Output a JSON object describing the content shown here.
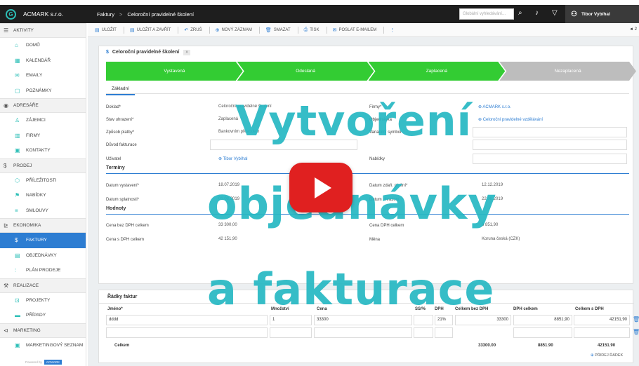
{
  "app": {
    "logo_letter": "G",
    "company": "ACMARK s.r.o."
  },
  "breadcrumb": {
    "root": "Faktury",
    "separator": ">",
    "current": "Celoroční pravidelné školení"
  },
  "search": {
    "placeholder": "Globální vyhledávání..."
  },
  "user": {
    "name": "Tibor Vybíhal"
  },
  "sidebar": {
    "sections": [
      {
        "label": "AKTIVITY",
        "icon": "activity-icon",
        "items": [
          {
            "label": "DOMŮ",
            "icon": "home-icon"
          },
          {
            "label": "KALENDÁŘ",
            "icon": "calendar-icon"
          },
          {
            "label": "EMAILY",
            "icon": "mail-icon"
          },
          {
            "label": "POZNÁMKY",
            "icon": "note-icon"
          }
        ]
      },
      {
        "label": "ADRESÁŘE",
        "icon": "addressbook-icon",
        "items": [
          {
            "label": "ZÁJEMCI",
            "icon": "person-icon"
          },
          {
            "label": "FIRMY",
            "icon": "building-icon"
          },
          {
            "label": "KONTAKTY",
            "icon": "contact-icon"
          }
        ]
      },
      {
        "label": "PRODEJ",
        "icon": "dollar-icon",
        "items": [
          {
            "label": "PŘÍLEŽITOSTI",
            "icon": "opportunity-icon"
          },
          {
            "label": "NABÍDKY",
            "icon": "offer-icon"
          },
          {
            "label": "SMLOUVY",
            "icon": "contract-icon"
          }
        ]
      },
      {
        "label": "EKONOMIKA",
        "icon": "chart-icon",
        "items": [
          {
            "label": "FAKTURY",
            "icon": "invoice-icon",
            "active": true
          },
          {
            "label": "OBJEDNÁVKY",
            "icon": "order-icon"
          },
          {
            "label": "PLÁN PRODEJE",
            "icon": "plan-icon"
          }
        ]
      },
      {
        "label": "REALIZACE",
        "icon": "realization-icon",
        "items": [
          {
            "label": "PROJEKTY",
            "icon": "project-icon"
          },
          {
            "label": "PŘÍPADY",
            "icon": "case-icon"
          }
        ]
      },
      {
        "label": "MARKETING",
        "icon": "marketing-icon",
        "items": [
          {
            "label": "MARKETINGOVÝ SEZNAM",
            "icon": "list-icon"
          }
        ]
      }
    ],
    "footer": {
      "text": "Powered by",
      "brand": "ACMARK"
    }
  },
  "toolbar": {
    "buttons": [
      {
        "label": "ULOŽIT",
        "icon": "save-icon"
      },
      {
        "label": "ULOŽIT A ZAVŘÍT",
        "icon": "save-close-icon"
      },
      {
        "label": "ZRUŠ",
        "icon": "undo-icon"
      },
      {
        "label": "NOVÝ ZÁZNAM",
        "icon": "plus-icon"
      },
      {
        "label": "SMAZAT",
        "icon": "trash-icon"
      },
      {
        "label": "TISK",
        "icon": "print-icon"
      },
      {
        "label": "POSLAT E-MAILEM",
        "icon": "email-icon"
      }
    ],
    "more": "⋮",
    "pager": "◄ 2"
  },
  "record": {
    "title_symbol": "$",
    "title": "Celoroční pravidelné školení",
    "title_button": "×",
    "steps": [
      {
        "label": "Vystavená",
        "state": "done"
      },
      {
        "label": "Odeslaná",
        "state": "done"
      },
      {
        "label": "Zaplacená",
        "state": "done"
      },
      {
        "label": "Nezaplacená",
        "state": "todo"
      }
    ],
    "tab": "Základní",
    "fields": {
      "doklad": {
        "label": "Doklad*",
        "value": "Celoroční pravidelné školení"
      },
      "stav": {
        "label": "Stav uhrazení*",
        "value": "Zaplacená"
      },
      "zpusob": {
        "label": "Způsob platby*",
        "value": "Bankovním převodem"
      },
      "duvod": {
        "label": "Důvod fakturace",
        "value": ""
      },
      "uzivatel": {
        "label": "Uživatel",
        "value": "Tibor Vybíhal"
      },
      "firmy": {
        "label": "Firmy*",
        "value": "ACMARK s.r.o."
      },
      "objednavka": {
        "label": "Objednávka",
        "value": "Celoroční pravidelné vzdělávání"
      },
      "variabilni": {
        "label": "Variabilní symbol",
        "value": ""
      },
      "nabidky": {
        "label": "Nabídky",
        "value": ""
      }
    },
    "terminy": {
      "title": "Termíny",
      "vystaveni": {
        "label": "Datum vystavení*",
        "value": "18.07.2019"
      },
      "splatnost": {
        "label": "Datum splatnosti*",
        "value": "01.08.2019"
      },
      "zdan": {
        "label": "Datum zdaň. plnění*",
        "value": "12.12.2019"
      },
      "uhrazeni": {
        "label": "Datum uhrazení",
        "value": "22.08.2019"
      }
    },
    "hodnoty": {
      "title": "Hodnoty",
      "bez_dph": {
        "label": "Cena bez DPH celkem",
        "value": "33 300,00"
      },
      "s_dph": {
        "label": "Cena s DPH celkem",
        "value": "42 151,90"
      },
      "dph": {
        "label": "Cena DPH celkem",
        "value": "8 851,90"
      },
      "mena": {
        "label": "Měna",
        "value": "Koruna česká (CZK)"
      }
    }
  },
  "lines": {
    "title": "Řádky faktur",
    "headers": {
      "name": "Jméno*",
      "qty": "Množství",
      "price": "Cena",
      "disc": "SS/%",
      "dph": "DPH",
      "total_ex": "Celkem bez DPH",
      "dph_total": "DPH celkem",
      "total_inc": "Celkem s DPH"
    },
    "rows": [
      {
        "name": "dddd",
        "qty": "1",
        "price": "33300",
        "dph": "21%",
        "total_ex": "33300",
        "dph_total": "8851,90",
        "total_inc": "42151,90"
      }
    ],
    "totals": {
      "label": "Celkem",
      "total_ex": "33300.00",
      "dph_total": "8851.90",
      "total_inc": "42151.90"
    },
    "add_row": "PŘIDEJ ŘÁDEK"
  },
  "overlay": {
    "line1": "Vytvoření",
    "line2": "objednávky",
    "line3": "a fakturace"
  },
  "colors": {
    "accent": "#2d7dd2",
    "done": "#33cc33",
    "todo": "#bdbdbd",
    "overlay": "#26b8c3",
    "play": "#e02020"
  }
}
